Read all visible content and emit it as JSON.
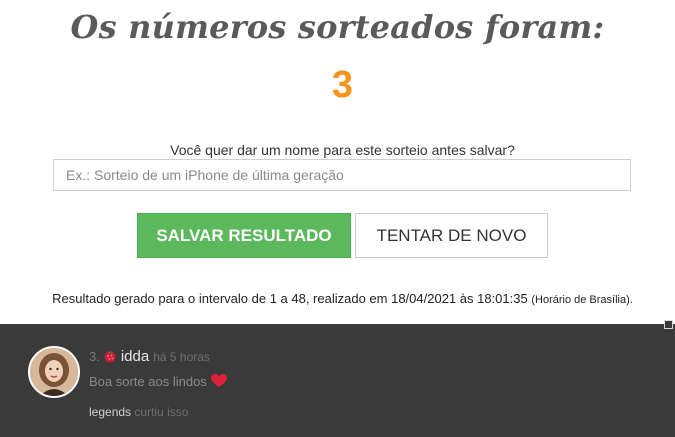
{
  "draw": {
    "headline": "Os números sorteados foram:",
    "result_number": "3"
  },
  "name_prompt": {
    "label": "Você quer dar um nome para este sorteio antes salvar?",
    "placeholder": "Ex.: Sorteio de um iPhone de última geração",
    "value": ""
  },
  "actions": {
    "save_label": "SALVAR RESULTADO",
    "retry_label": "TENTAR DE NOVO",
    "save_color": "#5cb85c"
  },
  "result_info": {
    "text": "Resultado gerado para o intervalo de 1 a 48, realizado em 18/04/2021 às 18:01:35",
    "timezone": "(Horário de Brasília)."
  },
  "feed": {
    "entry": {
      "rank": "3.",
      "badge_icon": "raspberry-icon",
      "username": "idda",
      "time_ago": "há 5 horas",
      "message": "Boa sorte aos lindos",
      "message_icon": "heart-icon",
      "liker": "legends",
      "liked_text": "curtiu isso"
    }
  }
}
